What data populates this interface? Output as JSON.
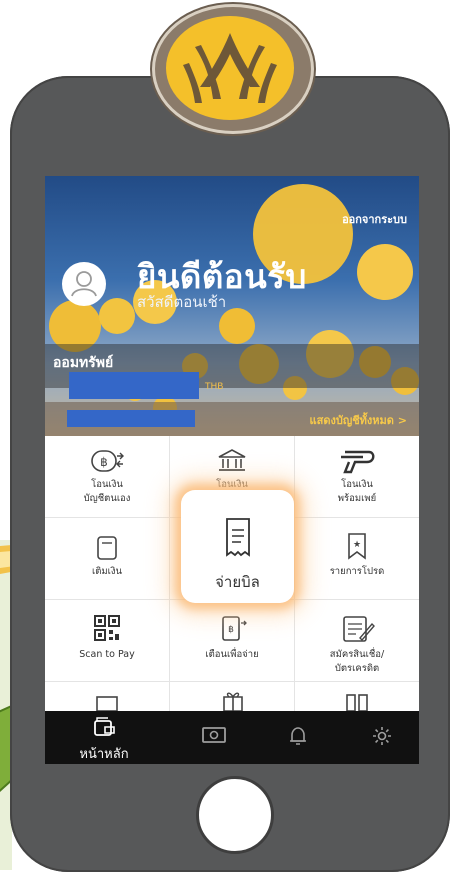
{
  "header": {
    "logout_label": "ออกจากระบบ",
    "welcome_title": "ยินดีต้อนรับ",
    "greeting": "สวัสดีตอนเช้า"
  },
  "account": {
    "type_label": "ออมทรัพย์",
    "currency": "THB",
    "show_all_label": "แสดงบัญชีทั้งหมด >"
  },
  "menu": {
    "transfer_own": {
      "line1": "โอนเงิน",
      "line2": "บัญชีตนเอง",
      "icon": "baht-transfer-icon"
    },
    "transfer": {
      "line1": "โอนเงิน",
      "icon": "bank-icon"
    },
    "promptpay": {
      "line1": "โอนเงิน",
      "line2": "พร้อมเพย์",
      "icon": "promptpay-icon"
    },
    "topup": {
      "line1": "เติมเงิน",
      "icon": "topup-icon"
    },
    "bill_payment": {
      "line1": "จ่ายบิล",
      "icon": "bill-icon"
    },
    "favorites": {
      "line1": "รายการโปรด",
      "icon": "favorite-star-icon"
    },
    "scan_to_pay": {
      "line1": "Scan to Pay",
      "icon": "qr-code-icon"
    },
    "payment_alert": {
      "line1": "เตือนเพื่อจ่าย",
      "icon": "payment-alert-icon"
    },
    "apply_credit": {
      "line1": "สมัครสินเชื่อ/",
      "line2": "บัตรเครดิต",
      "icon": "apply-form-icon"
    }
  },
  "nav": {
    "home_label": "หน้าหลัก",
    "items": [
      "home-icon",
      "cash-icon",
      "bell-icon",
      "settings-icon"
    ]
  },
  "colors": {
    "brand_yellow": "#f4c02a",
    "phone_body": "#575859",
    "nav_bg": "#111111",
    "highlight_glow": "#fab66e",
    "account_mask": "#3467c8"
  }
}
